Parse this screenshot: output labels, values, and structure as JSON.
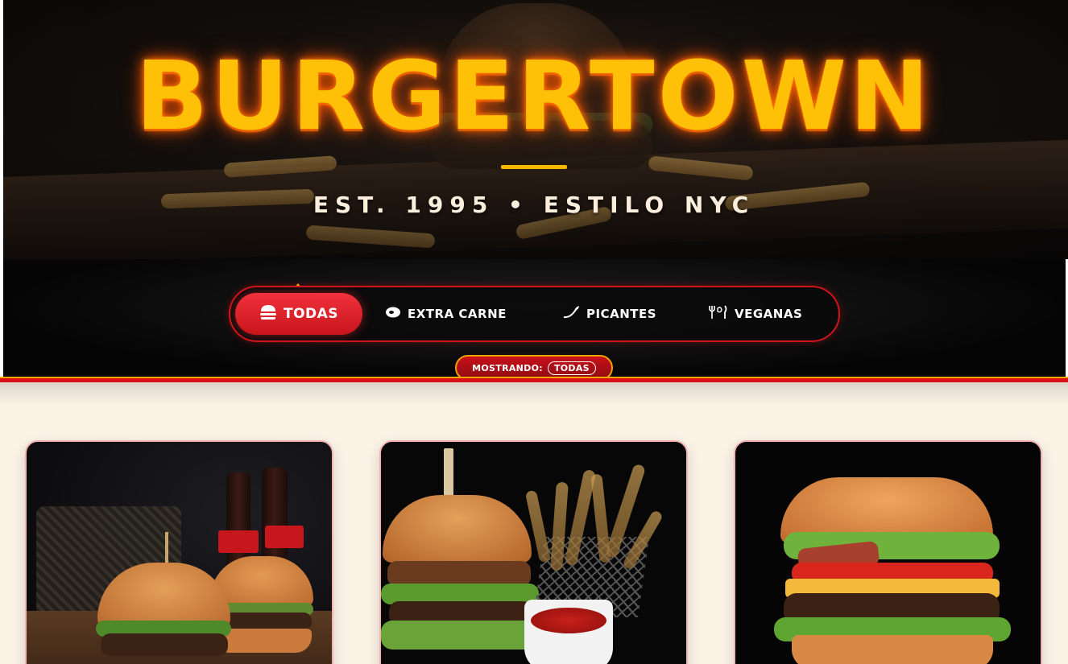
{
  "hero": {
    "title": "BURGERTOWN",
    "subtitle": "EST. 1995 • ESTILO NYC"
  },
  "filters": {
    "tabs": [
      {
        "label": "TODAS",
        "icon": "burger-icon",
        "active": true
      },
      {
        "label": "EXTRA CARNE",
        "icon": "meat-icon",
        "active": false
      },
      {
        "label": "PICANTES",
        "icon": "chili-pepper-icon",
        "active": false
      },
      {
        "label": "VEGANAS",
        "icon": "utensils-icon",
        "active": false
      }
    ],
    "status_label": "MOSTRANDO:",
    "status_value": "TODAS"
  },
  "colors": {
    "brand_yellow": "#ffc107",
    "brand_red": "#d80f16",
    "tag_green": "#1aa34a",
    "page_bg": "#fbf3e6"
  },
  "products": [
    {
      "image": "two-burgers-with-cola-bottles"
    },
    {
      "image": "burger-with-fries-and-ketchup"
    },
    {
      "image": "bacon-cheeseburger"
    }
  ]
}
